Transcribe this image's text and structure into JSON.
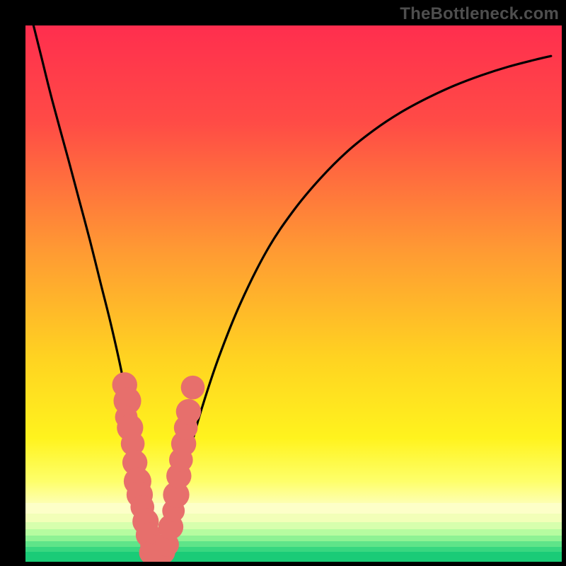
{
  "watermark": "TheBottleneck.com",
  "chart_data": {
    "type": "line",
    "title": "",
    "xlabel": "",
    "ylabel": "",
    "xlim": [
      0,
      100
    ],
    "ylim": [
      0,
      100
    ],
    "series": [
      {
        "name": "bottleneck-curve",
        "x": [
          1.5,
          3,
          5,
          8,
          10,
          12,
          14,
          16,
          18,
          19,
          20.5,
          22,
          23,
          24,
          25.2,
          27,
          29,
          31,
          33,
          36,
          40,
          45,
          50,
          55,
          60,
          65,
          70,
          75,
          80,
          85,
          90,
          95,
          98
        ],
        "values": [
          100,
          94,
          86,
          75,
          67.5,
          60,
          52,
          44,
          35,
          29,
          20,
          10,
          4,
          1.5,
          1.5,
          6,
          14,
          22,
          29,
          38,
          48,
          58,
          65.5,
          71.5,
          76.5,
          80.5,
          83.8,
          86.5,
          88.8,
          90.7,
          92.3,
          93.6,
          94.3
        ]
      }
    ],
    "scatter_overlay": {
      "name": "dots",
      "points": [
        {
          "x": 18.5,
          "y": 33,
          "r": 1.4
        },
        {
          "x": 19.0,
          "y": 30,
          "r": 1.6
        },
        {
          "x": 18.8,
          "y": 27,
          "r": 1.2
        },
        {
          "x": 19.5,
          "y": 25,
          "r": 1.5
        },
        {
          "x": 20.0,
          "y": 22,
          "r": 1.3
        },
        {
          "x": 20.4,
          "y": 18.5,
          "r": 1.4
        },
        {
          "x": 20.9,
          "y": 15,
          "r": 1.6
        },
        {
          "x": 21.3,
          "y": 12.5,
          "r": 1.5
        },
        {
          "x": 21.8,
          "y": 10.2,
          "r": 1.3
        },
        {
          "x": 22.4,
          "y": 7.5,
          "r": 1.5
        },
        {
          "x": 22.9,
          "y": 5.0,
          "r": 1.4
        },
        {
          "x": 23.5,
          "y": 3.0,
          "r": 1.2
        },
        {
          "x": 23.4,
          "y": 1.7,
          "r": 1.3
        },
        {
          "x": 24.2,
          "y": 1.4,
          "r": 1.3
        },
        {
          "x": 25.0,
          "y": 1.3,
          "r": 1.4
        },
        {
          "x": 25.7,
          "y": 1.8,
          "r": 1.3
        },
        {
          "x": 26.4,
          "y": 3.2,
          "r": 1.3
        },
        {
          "x": 27.1,
          "y": 6.5,
          "r": 1.4
        },
        {
          "x": 27.6,
          "y": 9.5,
          "r": 1.2
        },
        {
          "x": 28.1,
          "y": 12.5,
          "r": 1.5
        },
        {
          "x": 28.6,
          "y": 16.0,
          "r": 1.4
        },
        {
          "x": 29.0,
          "y": 19.0,
          "r": 1.3
        },
        {
          "x": 29.5,
          "y": 22.0,
          "r": 1.4
        },
        {
          "x": 29.9,
          "y": 25.0,
          "r": 1.3
        },
        {
          "x": 30.4,
          "y": 28.0,
          "r": 1.4
        },
        {
          "x": 31.2,
          "y": 32.5,
          "r": 1.3
        }
      ]
    },
    "gradient_stops": [
      {
        "pct": 0,
        "color": "#ff2e4e"
      },
      {
        "pct": 18,
        "color": "#ff4b46"
      },
      {
        "pct": 42,
        "color": "#ff9a33"
      },
      {
        "pct": 62,
        "color": "#ffd321"
      },
      {
        "pct": 77,
        "color": "#fff31e"
      },
      {
        "pct": 85,
        "color": "#feff6a"
      },
      {
        "pct": 89,
        "color": "#fdffb0"
      }
    ],
    "bottom_bands": [
      {
        "top_pct": 89.0,
        "h_pct": 2.0,
        "color": "#fdffc8"
      },
      {
        "top_pct": 91.0,
        "h_pct": 1.6,
        "color": "#f2ffb8"
      },
      {
        "top_pct": 92.6,
        "h_pct": 1.3,
        "color": "#d7ffad"
      },
      {
        "top_pct": 93.9,
        "h_pct": 1.2,
        "color": "#b6fca0"
      },
      {
        "top_pct": 95.1,
        "h_pct": 1.1,
        "color": "#8ef294"
      },
      {
        "top_pct": 96.2,
        "h_pct": 1.0,
        "color": "#5fe489"
      },
      {
        "top_pct": 97.2,
        "h_pct": 1.0,
        "color": "#38d780"
      },
      {
        "top_pct": 98.2,
        "h_pct": 1.8,
        "color": "#1acb77"
      }
    ]
  }
}
